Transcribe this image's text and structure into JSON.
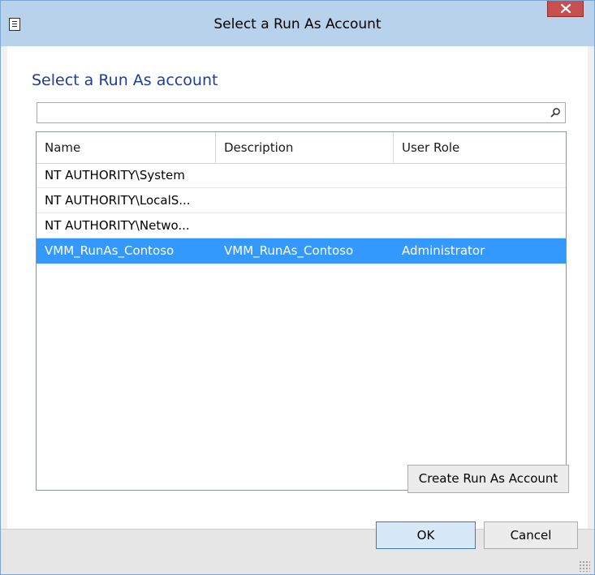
{
  "window": {
    "title": "Select a Run As Account",
    "close_icon": "close-icon",
    "app_icon": "dialog-icon"
  },
  "dialog": {
    "heading": "Select a Run As account",
    "search": {
      "value": "",
      "placeholder": "",
      "icon": "search-icon"
    },
    "columns": [
      "Name",
      "Description",
      "User Role"
    ],
    "rows": [
      {
        "name": "NT AUTHORITY\\System",
        "description": "",
        "role": ""
      },
      {
        "name": "NT AUTHORITY\\LocalS...",
        "description": "",
        "role": ""
      },
      {
        "name": "NT AUTHORITY\\Netwo...",
        "description": "",
        "role": ""
      },
      {
        "name": "VMM_RunAs_Contoso",
        "description": "VMM_RunAs_Contoso",
        "role": "Administrator",
        "selected": true
      }
    ],
    "create_button": "Create Run As Account"
  },
  "footer": {
    "ok": "OK",
    "cancel": "Cancel"
  },
  "colors": {
    "title_bar": "#b8d2ec",
    "heading": "#1e3c9a",
    "selection": "#3399ff",
    "close": "#c74f4f"
  }
}
